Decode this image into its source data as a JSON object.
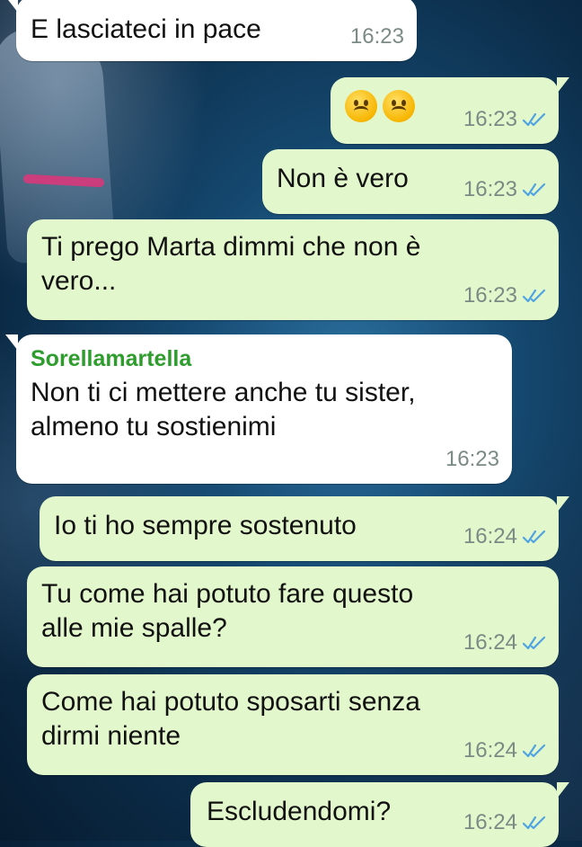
{
  "messages": [
    {
      "direction": "in",
      "text": "E lasciateci in pace",
      "time": "16:23"
    },
    {
      "direction": "out",
      "emoji": [
        "frowning-face",
        "frowning-face"
      ],
      "time": "16:23",
      "status": "read"
    },
    {
      "direction": "out",
      "text": "Non è vero",
      "time": "16:23",
      "status": "read"
    },
    {
      "direction": "out",
      "text": "Ti prego Marta dimmi che non è\nvero...",
      "time": "16:23",
      "status": "read"
    },
    {
      "direction": "in",
      "sender": "Sorellamartella",
      "text": "Non ti ci mettere anche tu sister,\nalmeno tu sostienimi",
      "time": "16:23"
    },
    {
      "direction": "out",
      "text": "Io ti ho sempre sostenuto",
      "time": "16:24",
      "status": "read"
    },
    {
      "direction": "out",
      "text": "Tu come hai potuto fare questo\nalle mie spalle?",
      "time": "16:24",
      "status": "read"
    },
    {
      "direction": "out",
      "text": "Come hai potuto sposarti senza\ndirmi niente",
      "time": "16:24",
      "status": "read"
    },
    {
      "direction": "out",
      "text": "Escludendomi?",
      "time": "16:24",
      "status": "read"
    }
  ],
  "colors": {
    "incoming_bubble": "#ffffff",
    "outgoing_bubble": "#e2f7cb",
    "sender_name": "#2e9d2e",
    "read_tick": "#4fa3e3",
    "timestamp": "#7b8a85"
  }
}
